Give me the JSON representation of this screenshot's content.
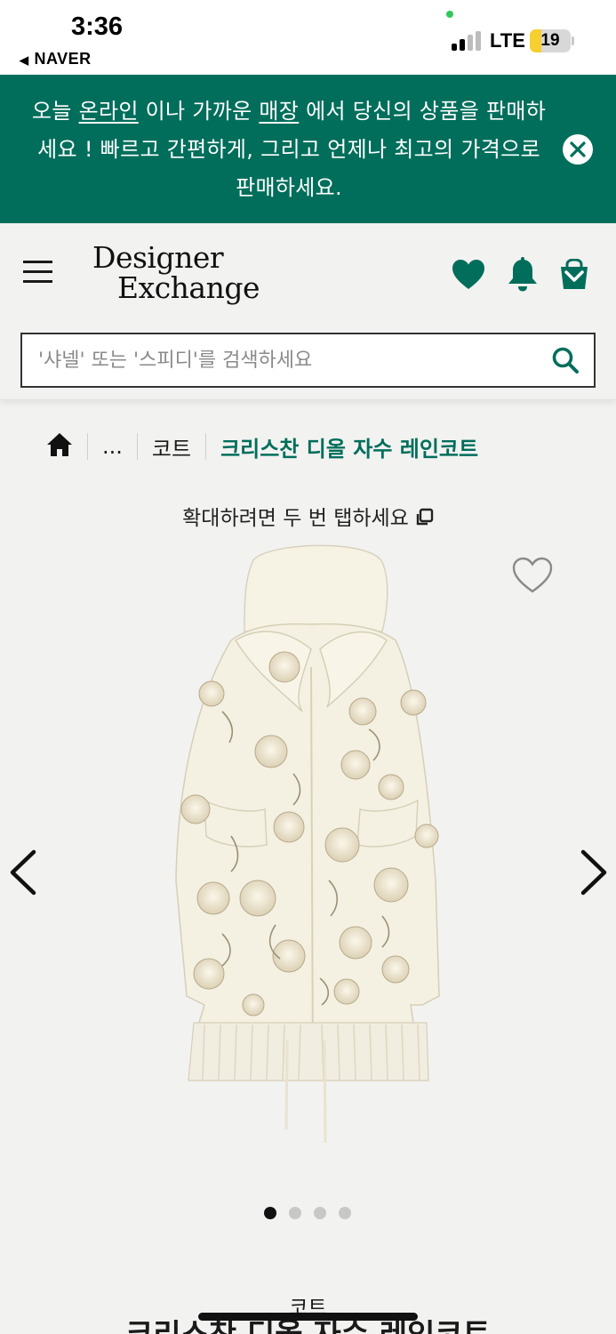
{
  "status_bar": {
    "time": "3:36",
    "back_app": "NAVER",
    "network": "LTE",
    "battery": "19",
    "battery_level": 0.19
  },
  "promo": {
    "part1": "오늘 ",
    "link_online": "온라인",
    "part2": " 이나 가까운 ",
    "link_store": "매장",
    "part3": " 에서 당신의 상품을 판매하세요 ! 빠르고 간편하게, 그리고 언제나 최고의 가격으로 판매하세요.",
    "close_icon": "close-icon"
  },
  "header": {
    "logo_line1": "Designer",
    "logo_line2": "Exchange",
    "icons": [
      "heart-icon",
      "bell-icon",
      "bag-icon"
    ]
  },
  "search": {
    "placeholder": "'샤넬' 또는 '스피디'를 검색하세요"
  },
  "breadcrumb": {
    "ellipsis": "...",
    "category": "코트",
    "current": "크리스찬 디올 자수 레인코트"
  },
  "gallery": {
    "zoom_hint": "확대하려면 두 번 탭하세요",
    "image_count": 4,
    "active_index": 0
  },
  "product": {
    "category": "코트",
    "title": "크리스찬 디올 자수 레인코트"
  },
  "colors": {
    "brand_green": "#006e5b",
    "background": "#f2f2f1"
  }
}
